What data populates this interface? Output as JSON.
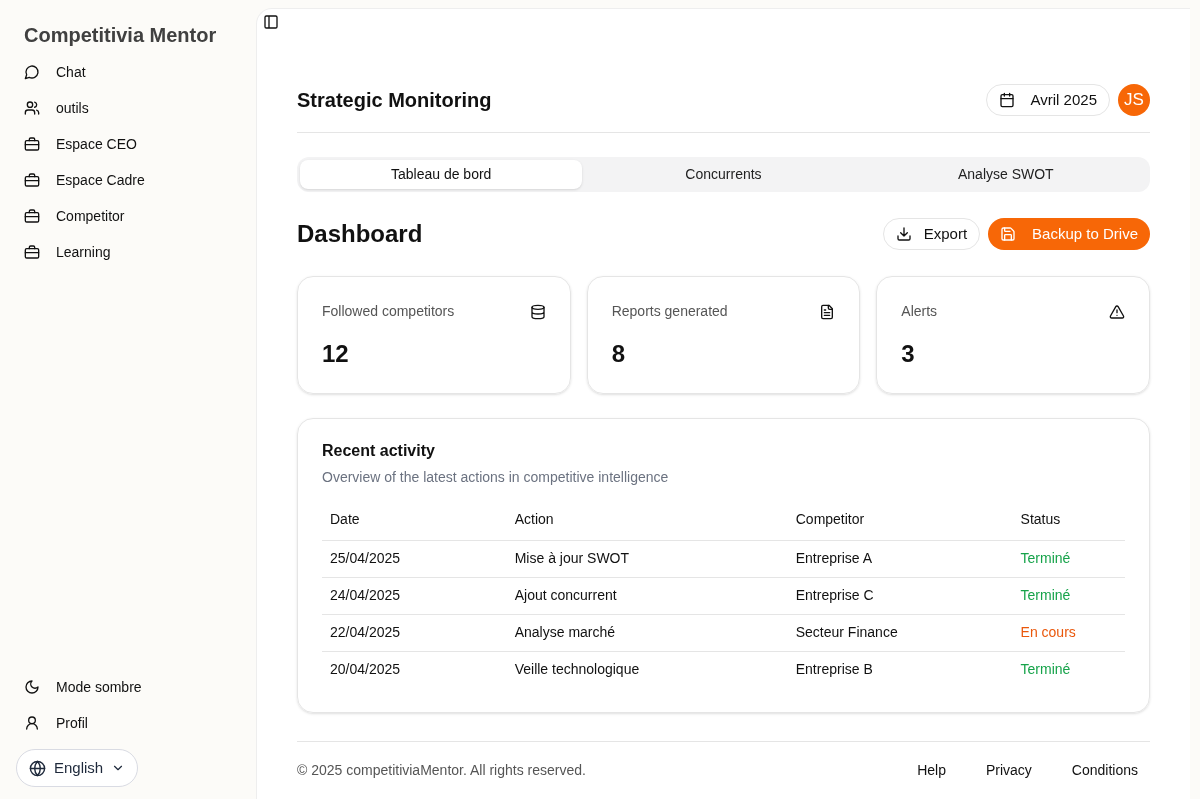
{
  "sidebar": {
    "title": "Competitivia Mentor",
    "items": [
      {
        "label": "Chat"
      },
      {
        "label": "outils"
      },
      {
        "label": "Espace CEO"
      },
      {
        "label": "Espace Cadre"
      },
      {
        "label": "Competitor"
      },
      {
        "label": "Learning"
      }
    ],
    "bottom_items": [
      {
        "label": "Mode sombre"
      },
      {
        "label": "Profil"
      }
    ],
    "language": "English"
  },
  "header": {
    "title": "Strategic Monitoring",
    "date": "Avril 2025",
    "avatar": "JS"
  },
  "tabs": [
    {
      "label": "Tableau de bord",
      "selected": true
    },
    {
      "label": "Concurrents",
      "selected": false
    },
    {
      "label": "Analyse SWOT",
      "selected": false
    }
  ],
  "dashboard": {
    "title": "Dashboard",
    "export": "Export",
    "backup": "Backup to Drive"
  },
  "stats": [
    {
      "label": "Followed competitors",
      "value": "12"
    },
    {
      "label": "Reports generated",
      "value": "8"
    },
    {
      "label": "Alerts",
      "value": "3"
    }
  ],
  "activity": {
    "title": "Recent activity",
    "subtitle": "Overview of the latest actions in competitive intelligence",
    "columns": [
      "Date",
      "Action",
      "Competitor",
      "Status"
    ],
    "rows": [
      {
        "date": "25/04/2025",
        "action": "Mise à jour SWOT",
        "competitor": "Entreprise A",
        "status": "Terminé",
        "color": "#16a34a"
      },
      {
        "date": "24/04/2025",
        "action": "Ajout concurrent",
        "competitor": "Entreprise C",
        "status": "Terminé",
        "color": "#16a34a"
      },
      {
        "date": "22/04/2025",
        "action": "Analyse marché",
        "competitor": "Secteur Finance",
        "status": "En cours",
        "color": "#ea580c"
      },
      {
        "date": "20/04/2025",
        "action": "Veille technologique",
        "competitor": "Entreprise B",
        "status": "Terminé",
        "color": "#16a34a"
      }
    ]
  },
  "footer": {
    "copyright": "© 2025 competitiviaMentor. All rights reserved.",
    "links": [
      "Help",
      "Privacy",
      "Conditions"
    ]
  }
}
